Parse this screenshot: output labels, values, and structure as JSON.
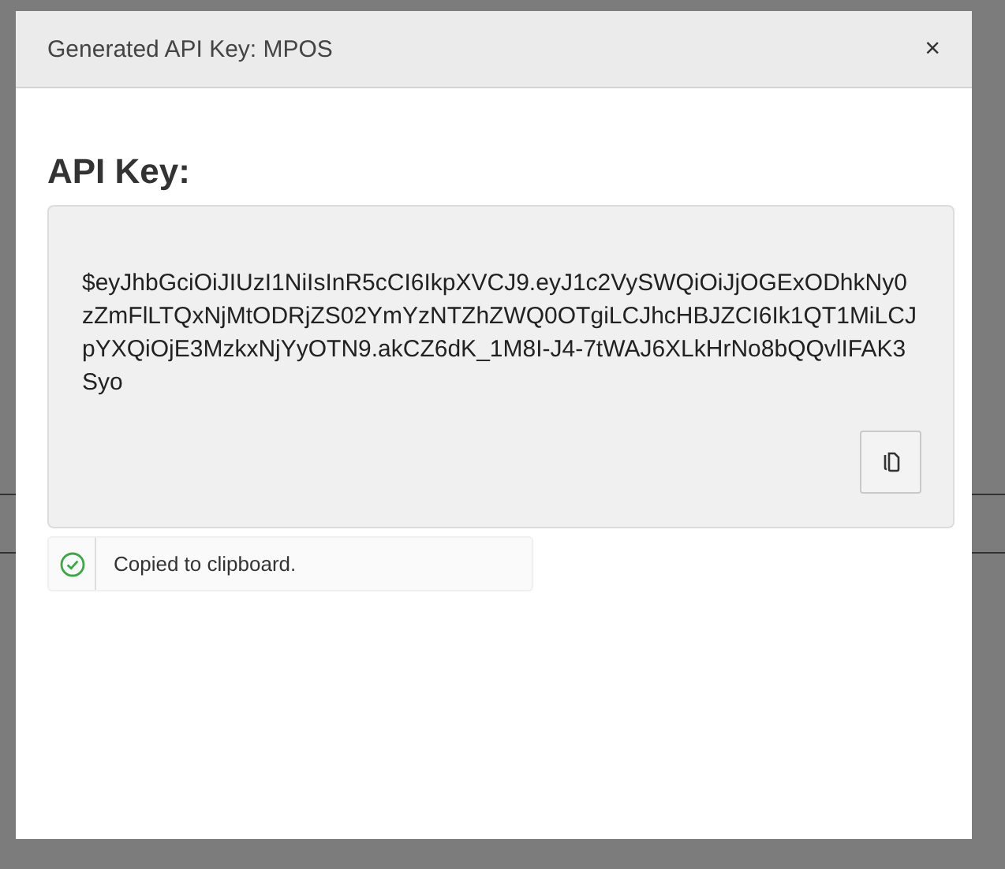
{
  "dialog": {
    "title": "Generated API Key: MPOS",
    "close": "×",
    "heading": "API Key:",
    "api_key": "$eyJhbGciOiJIUzI1NiIsInR5cCI6IkpXVCJ9.eyJ1c2VySWQiOiJjOGExODhkNy0zZmFlLTQxNjMtODRjZS02YmYzNTZhZWQ0OTgiLCJhcHBJZCI6Ik1QT1MiLCJpYXQiOjE3MzkxNjYyOTN9.akCZ6dK_1M8I-J4-7tWAJ6XLkHrNo8bQQvlIFAK3Syo",
    "toast": {
      "message": "Copied to clipboard.",
      "success": true
    }
  }
}
